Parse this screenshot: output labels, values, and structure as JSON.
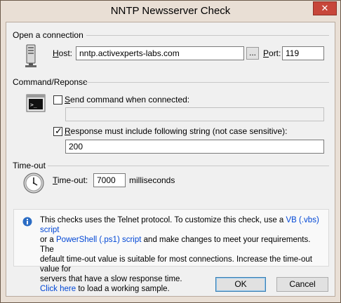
{
  "window": {
    "title": "NNTP Newsserver Check",
    "close_glyph": "✕"
  },
  "connection": {
    "group_title": "Open a connection",
    "host_label": "Host:",
    "host_value": "nntp.activexperts-labs.com",
    "browse_label": "...",
    "port_label": "Port:",
    "port_value": "119"
  },
  "command": {
    "group_title": "Command/Reponse",
    "send_checkbox_label": "Send command when connected:",
    "send_checked": false,
    "send_value": "",
    "response_checkbox_label": "Response must include following string (not case sensitive):",
    "response_checked": true,
    "response_value": "200"
  },
  "timeout": {
    "group_title": "Time-out",
    "label": "Time-out:",
    "value": "7000",
    "unit": "milliseconds"
  },
  "info": {
    "line1_a": "This checks uses the Telnet protocol. To customize this check, use a ",
    "vb_link": "VB (.vbs) script",
    "line2_a": "or a ",
    "ps_link": "PowerShell (.ps1) script",
    "line2_b": " and make changes to meet your requirements. The",
    "line3": "default time-out value is suitable for most connections. Increase the time-out value for",
    "line4": "servers that have a slow response time.",
    "click_link": "Click here",
    "line5_b": " to load a working sample."
  },
  "buttons": {
    "ok": "OK",
    "cancel": "Cancel"
  }
}
